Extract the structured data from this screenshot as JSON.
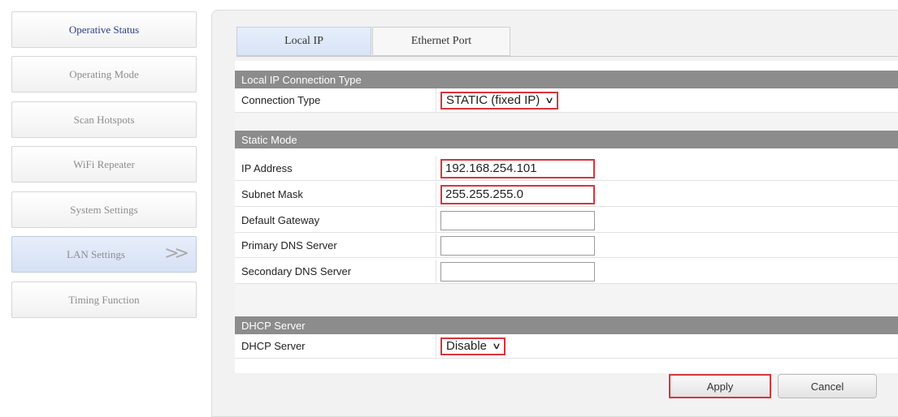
{
  "sidebar": {
    "items": [
      {
        "label": "Operative Status"
      },
      {
        "label": "Operating Mode"
      },
      {
        "label": "Scan Hotspots"
      },
      {
        "label": "WiFi Repeater"
      },
      {
        "label": "System Settings"
      },
      {
        "label": "LAN Settings",
        "indicator": ">>"
      },
      {
        "label": "Timing Function"
      }
    ],
    "active_index": 5
  },
  "tabs": [
    {
      "label": "Local IP"
    },
    {
      "label": "Ethernet Port"
    }
  ],
  "sections": {
    "connection": {
      "header": "Local IP Connection Type",
      "type_label": "Connection Type",
      "type_value": "STATIC (fixed IP)"
    },
    "static": {
      "header": "Static Mode",
      "ip_label": "IP Address",
      "ip_value": "192.168.254.101",
      "mask_label": "Subnet Mask",
      "mask_value": "255.255.255.0",
      "gateway_label": "Default Gateway",
      "gateway_value": "",
      "dns1_label": "Primary DNS Server",
      "dns1_value": "",
      "dns2_label": "Secondary DNS Server",
      "dns2_value": ""
    },
    "dhcp": {
      "header": "DHCP Server",
      "server_label": "DHCP Server",
      "server_value": "Disable"
    }
  },
  "buttons": {
    "apply": "Apply",
    "cancel": "Cancel"
  },
  "icons": {
    "dropdown": "chevron-down-icon",
    "nav_indicator": "double-chevron-right-icon"
  },
  "colors": {
    "highlight": "#d9343b",
    "section_header": "#8c8c8c",
    "active_tab": "#dde6f7"
  }
}
